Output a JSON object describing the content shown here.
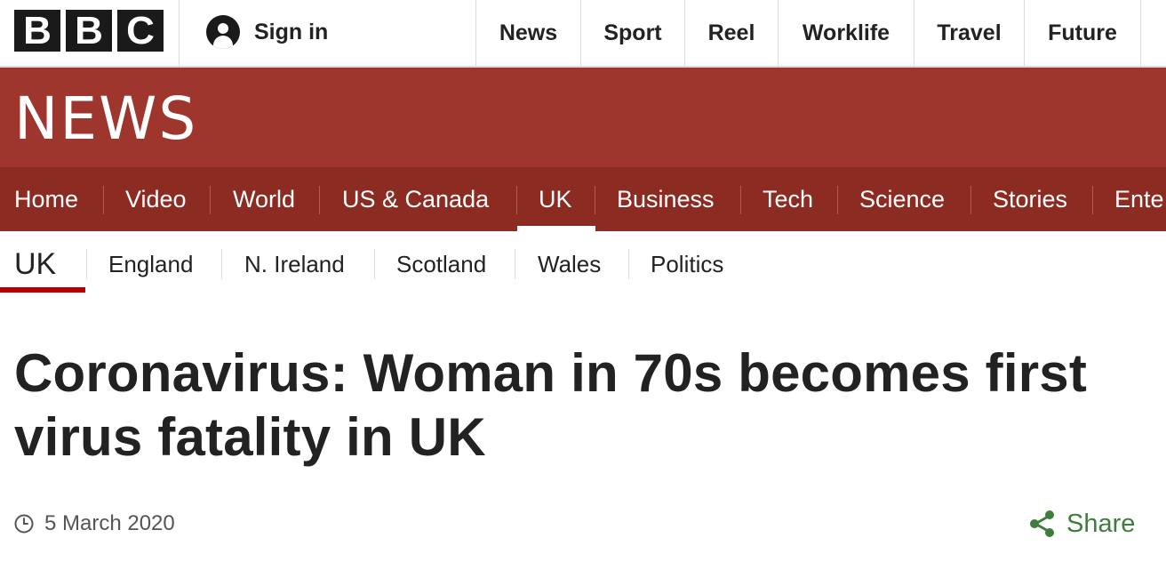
{
  "global_nav": {
    "logo_letters": [
      "B",
      "B",
      "C"
    ],
    "sign_in_label": "Sign in",
    "items": [
      "News",
      "Sport",
      "Reel",
      "Worklife",
      "Travel",
      "Future"
    ]
  },
  "masthead": {
    "title": "NEWS"
  },
  "section_nav": {
    "items": [
      "Home",
      "Video",
      "World",
      "US & Canada",
      "UK",
      "Business",
      "Tech",
      "Science",
      "Stories",
      "Ente"
    ],
    "active": "UK"
  },
  "sub_nav": {
    "active_label": "UK",
    "items": [
      "England",
      "N. Ireland",
      "Scotland",
      "Wales",
      "Politics"
    ]
  },
  "article": {
    "headline": "Coronavirus: Woman in 70s becomes first virus fatality in UK",
    "date": "5 March 2020",
    "share_label": "Share"
  },
  "colors": {
    "masthead": "#9e362d",
    "section_nav": "#8c2b22",
    "active_underline": "#b80000",
    "share": "#3f7d3a"
  },
  "icons": [
    "user-icon",
    "clock-icon",
    "share-icon"
  ]
}
